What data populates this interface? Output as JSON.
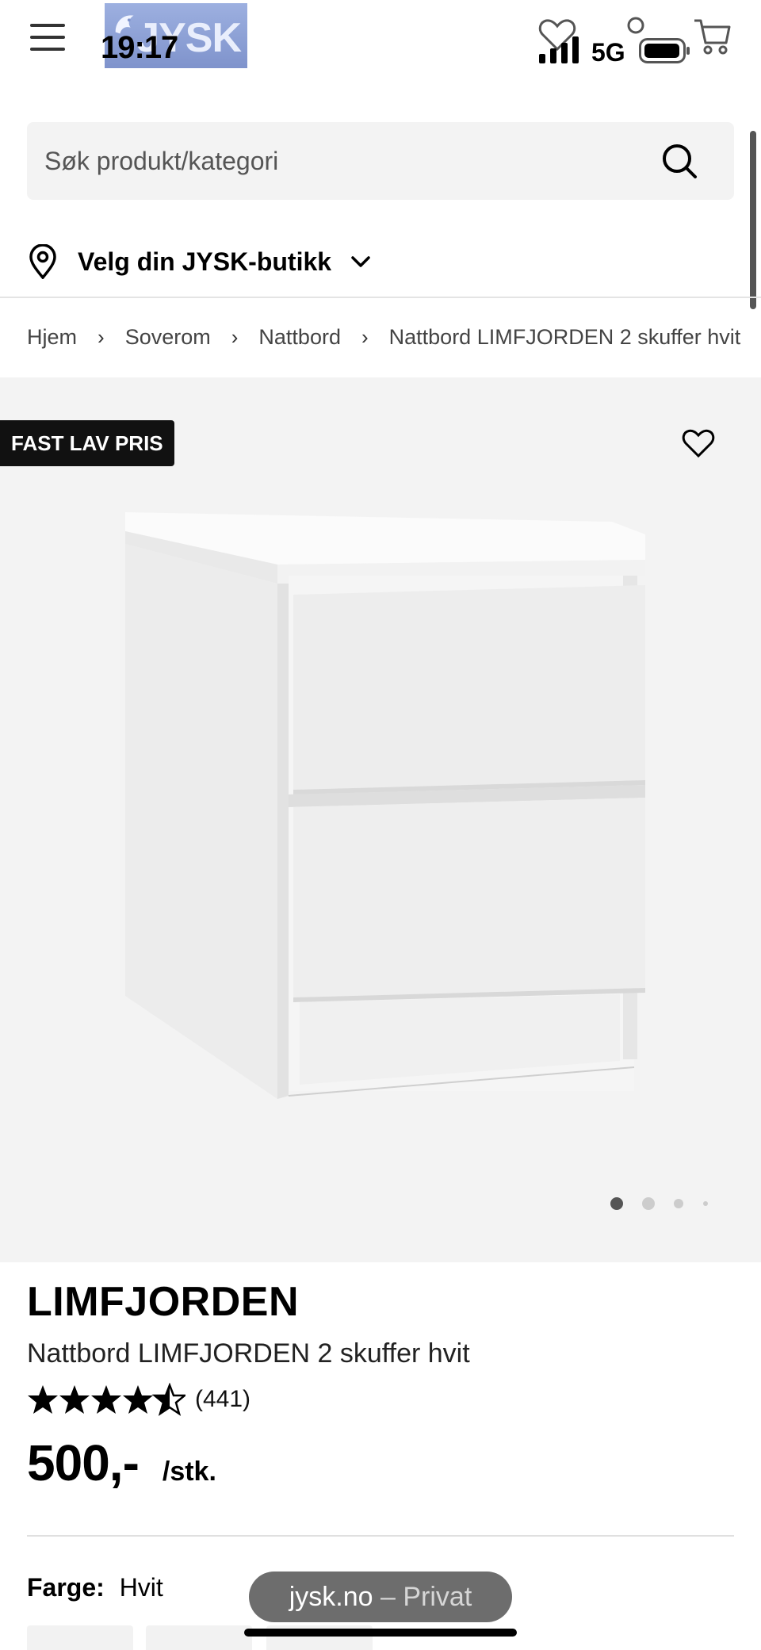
{
  "status_bar": {
    "time": "19:17",
    "network": "5G"
  },
  "header": {
    "logo_text": "JYSK"
  },
  "search": {
    "placeholder": "Søk produkt/kategori"
  },
  "store": {
    "label": "Velg din JYSK-butikk"
  },
  "breadcrumb": {
    "items": [
      "Hjem",
      "Soverom",
      "Nattbord",
      "Nattbord LIMFJORDEN 2 skuffer hvit"
    ],
    "separator": "›"
  },
  "gallery": {
    "badge": "FAST LAV PRIS",
    "image_count": 4,
    "active_image": 1
  },
  "product": {
    "brand": "LIMFJORDEN",
    "name": "Nattbord LIMFJORDEN 2 skuffer hvit",
    "rating": 4.5,
    "rating_max": 5,
    "review_count": "(441)",
    "price": "500,-",
    "price_unit": "/stk.",
    "color_label": "Farge:",
    "color_value": "Hvit"
  },
  "browser": {
    "domain": "jysk.no",
    "separator": " – ",
    "mode": "Privat"
  },
  "colors": {
    "text": "#000000",
    "gallery_bg": "#f3f3f3",
    "badge_bg": "#111111",
    "pill_bg": "#6d6d6d"
  }
}
